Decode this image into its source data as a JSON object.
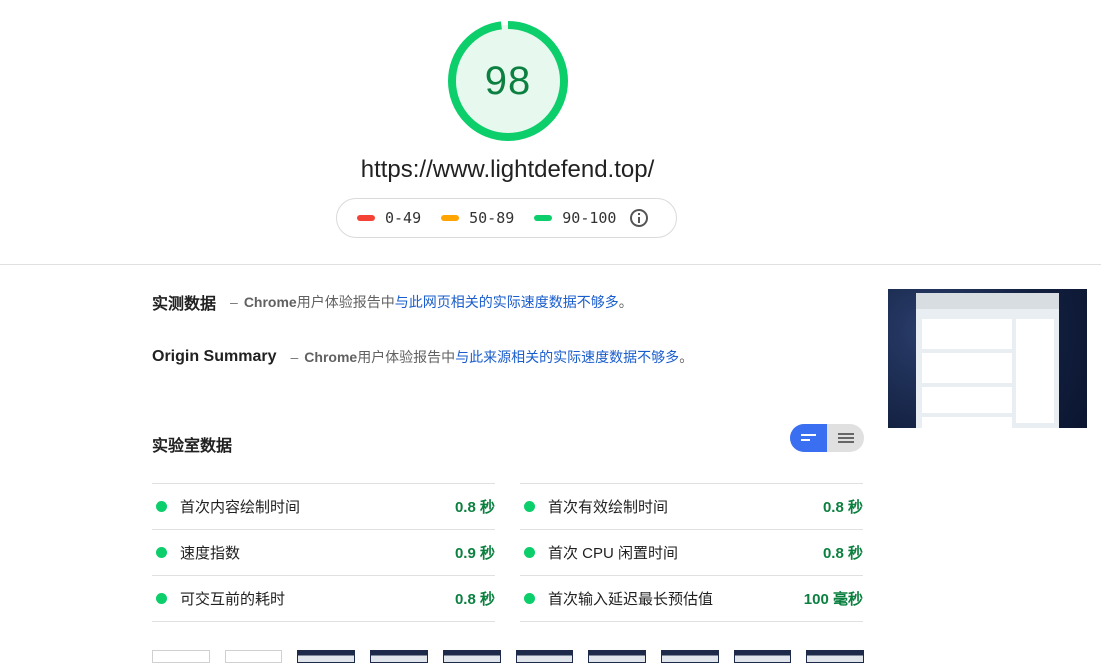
{
  "score": {
    "value": "98",
    "color": "#0cce6b",
    "fraction": 0.98
  },
  "url": "https://www.lightdefend.top/",
  "legend": [
    {
      "label": "0-49",
      "color": "#f44336"
    },
    {
      "label": "50-89",
      "color": "#ffa400"
    },
    {
      "label": "90-100",
      "color": "#0cce6b"
    }
  ],
  "field": {
    "title": "实测数据",
    "dash": "–",
    "source": "Chrome",
    "text_prefix": " 用户体验报告中",
    "link": "与此网页相关的实际速度数据不够多",
    "suffix": "。"
  },
  "origin": {
    "title": "Origin Summary",
    "dash": "–",
    "source": "Chrome",
    "text_prefix": " 用户体验报告中",
    "link": "与此来源相关的实际速度数据不够多",
    "suffix": "。"
  },
  "lab": {
    "title": "实验室数据",
    "left": [
      {
        "name": "首次内容绘制时间",
        "value": "0.8 秒"
      },
      {
        "name": "速度指数",
        "value": "0.9 秒"
      },
      {
        "name": "可交互前的耗时",
        "value": "0.8 秒"
      }
    ],
    "right": [
      {
        "name": "首次有效绘制时间",
        "value": "0.8 秒"
      },
      {
        "name": "首次 CPU 闲置时间",
        "value": "0.8 秒"
      },
      {
        "name": "首次输入延迟最长预估值",
        "value": "100 毫秒"
      }
    ]
  },
  "colors": {
    "pass": "#0cce6b",
    "pass_text": "#0c8040",
    "link": "#1a5dcc",
    "toggle_active": "#3a6ff2"
  }
}
